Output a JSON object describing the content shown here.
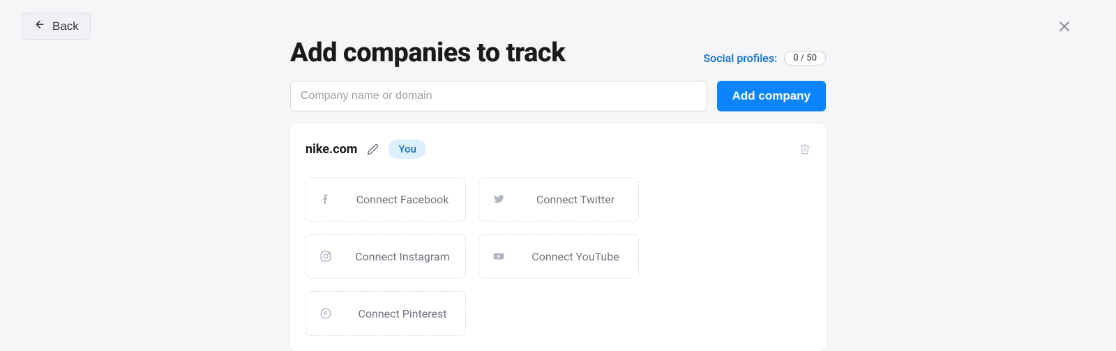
{
  "back": {
    "label": "Back"
  },
  "header": {
    "title": "Add companies to track",
    "social_profiles_label": "Social profiles:",
    "social_profiles_count": "0 / 50"
  },
  "input": {
    "placeholder": "Company name or domain",
    "add_button_label": "Add company"
  },
  "company": {
    "name": "nike.com",
    "badge": "You",
    "connections": [
      {
        "label": "Connect Facebook",
        "icon": "facebook-icon"
      },
      {
        "label": "Connect Twitter",
        "icon": "twitter-icon"
      },
      {
        "label": "Connect Instagram",
        "icon": "instagram-icon"
      },
      {
        "label": "Connect YouTube",
        "icon": "youtube-icon"
      },
      {
        "label": "Connect Pinterest",
        "icon": "pinterest-icon"
      }
    ]
  }
}
